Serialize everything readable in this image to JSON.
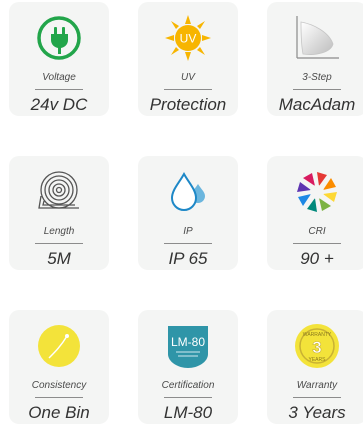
{
  "specs": [
    {
      "label": "Voltage",
      "value": "24v DC",
      "icon": "plug-icon"
    },
    {
      "label": "UV",
      "value": "Protection",
      "icon": "sun-uv-icon"
    },
    {
      "label": "3-Step",
      "value": "MacAdam",
      "icon": "macadam-icon"
    },
    {
      "label": "Length",
      "value": "5M",
      "icon": "reel-icon"
    },
    {
      "label": "IP",
      "value": "IP 65",
      "icon": "water-drop-icon"
    },
    {
      "label": "CRI",
      "value": "90 +",
      "icon": "color-wheel-icon"
    },
    {
      "label": "Consistency",
      "value": "One Bin",
      "icon": "bin-icon"
    },
    {
      "label": "Certification",
      "value": "LM-80",
      "icon": "lm80-badge-icon"
    },
    {
      "label": "Warranty",
      "value": "3 Years",
      "icon": "warranty-badge-icon"
    }
  ],
  "badges": {
    "uv": "UV",
    "lm": "LM-80",
    "warranty_number": "3",
    "warranty_top": "WARRANTY",
    "warranty_bottom": "YEARS"
  },
  "colors": {
    "card_bg": "#f4f5f4",
    "green": "#22a54a",
    "sun": "#f7b500",
    "blue": "#1e88c7",
    "teal": "#2f95a8",
    "yellow": "#f3e33a",
    "gold": "#c9b233"
  }
}
